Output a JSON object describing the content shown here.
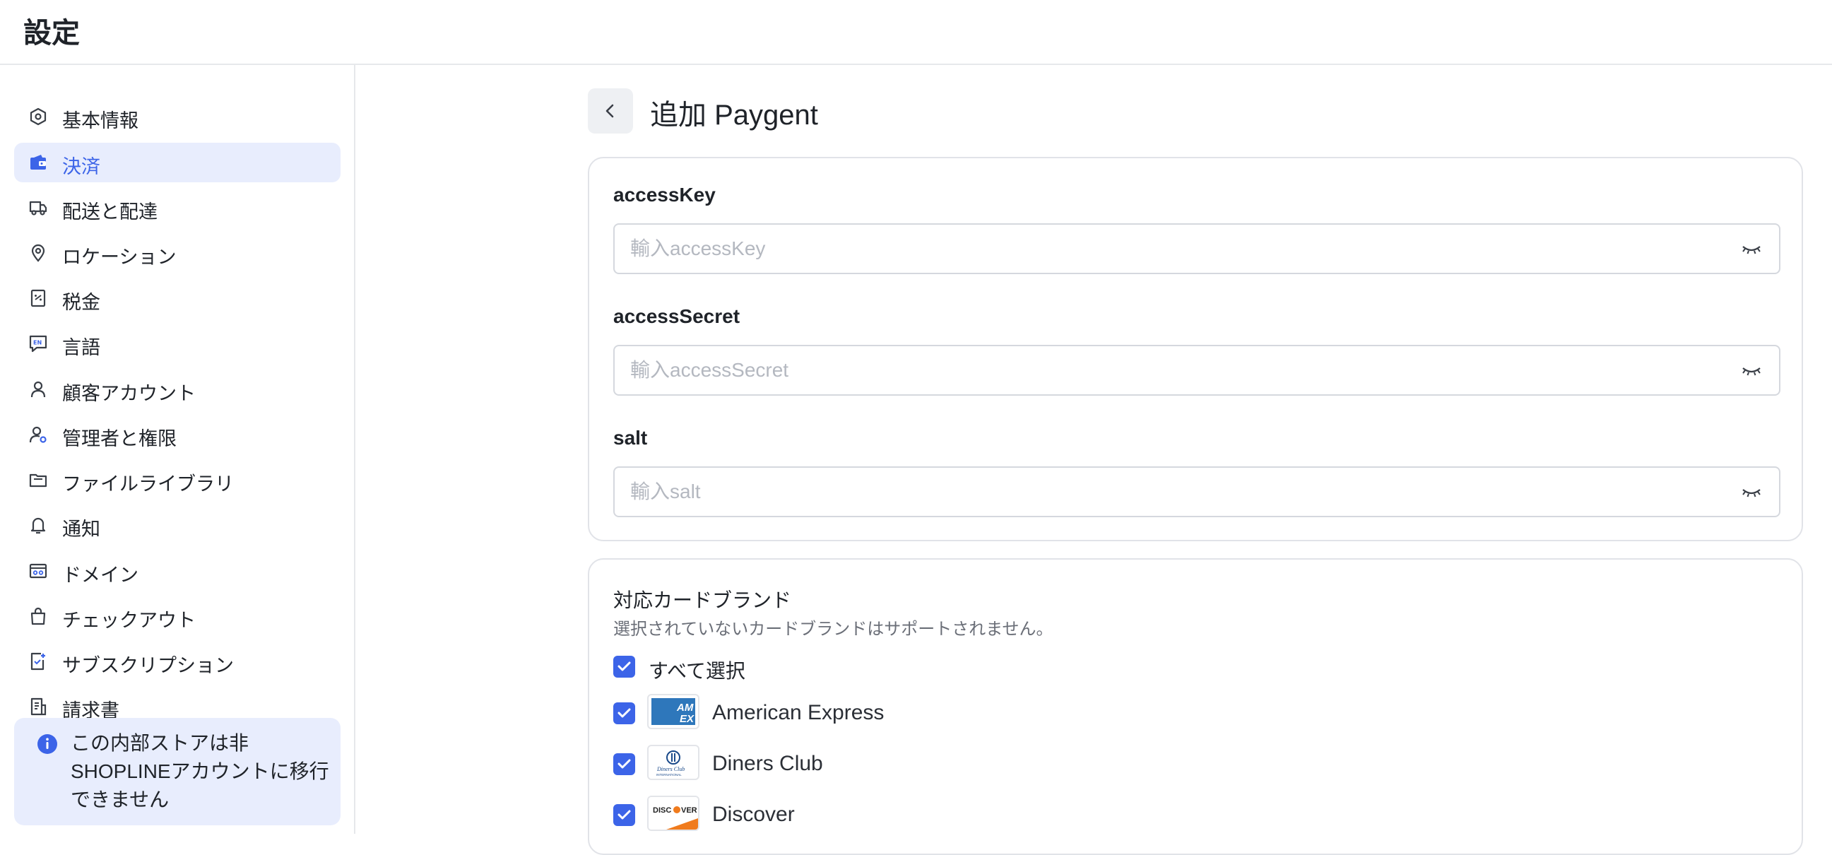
{
  "header": {
    "title": "設定"
  },
  "sidebar": {
    "items": [
      {
        "label": "基本情報",
        "icon": "hexagon-icon",
        "active": false
      },
      {
        "label": "決済",
        "icon": "wallet-icon",
        "active": true
      },
      {
        "label": "配送と配達",
        "icon": "truck-icon",
        "active": false
      },
      {
        "label": "ロケーション",
        "icon": "location-pin-icon",
        "active": false
      },
      {
        "label": "税金",
        "icon": "tax-receipt-icon",
        "active": false
      },
      {
        "label": "言語",
        "icon": "language-icon",
        "active": false
      },
      {
        "label": "顧客アカウント",
        "icon": "user-icon",
        "active": false
      },
      {
        "label": "管理者と権限",
        "icon": "user-permission-icon",
        "active": false
      },
      {
        "label": "ファイルライブラリ",
        "icon": "folder-icon",
        "active": false
      },
      {
        "label": "通知",
        "icon": "bell-icon",
        "active": false
      },
      {
        "label": "ドメイン",
        "icon": "domain-icon",
        "active": false
      },
      {
        "label": "チェックアウト",
        "icon": "shopping-bag-icon",
        "active": false
      },
      {
        "label": "サブスクリプション",
        "icon": "subscription-icon",
        "active": false
      },
      {
        "label": "請求書",
        "icon": "invoice-icon",
        "active": false
      }
    ],
    "notice": {
      "text": "この内部ストアは非SHOPLINEアカウントに移行できません",
      "icon": "info-icon"
    }
  },
  "main": {
    "title": "追加 Paygent",
    "fields": [
      {
        "label": "accessKey",
        "placeholder": "輸入accessKey",
        "value": ""
      },
      {
        "label": "accessSecret",
        "placeholder": "輸入accessSecret",
        "value": ""
      },
      {
        "label": "salt",
        "placeholder": "輸入salt",
        "value": ""
      }
    ],
    "cards_section": {
      "title": "対応カードブランド",
      "subtitle": "選択されていないカードブランドはサポートされません。",
      "select_all": "すべて選択",
      "brands": [
        {
          "name": "American Express",
          "checked": true,
          "logo_text": "AM EX"
        },
        {
          "name": "Diners Club",
          "checked": true,
          "logo_text": "Diners Club"
        },
        {
          "name": "Discover",
          "checked": true,
          "logo_text": "DISCOVER"
        }
      ]
    }
  },
  "colors": {
    "accent": "#3c64e8",
    "active_bg": "#e8edfd",
    "text": "#1f2329",
    "muted": "#6b6f78",
    "border": "#e1e3e8"
  }
}
